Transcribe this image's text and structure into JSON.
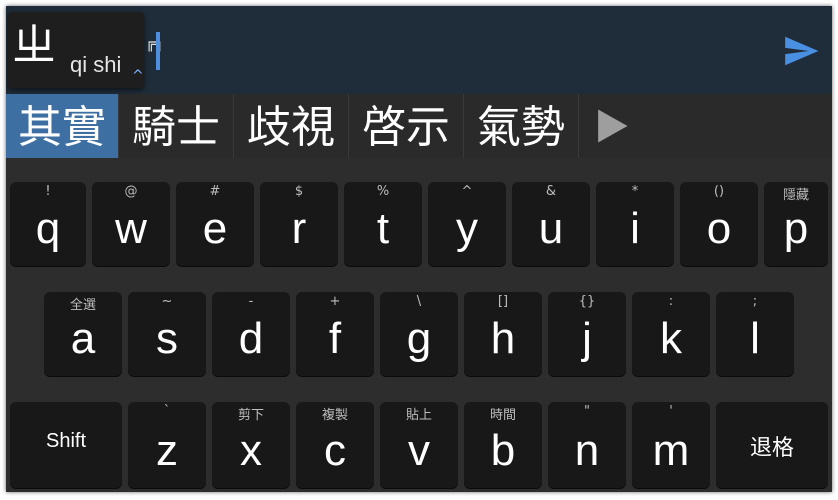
{
  "composer": {
    "zhuyin": "ㄓ",
    "pinyin": "qi shi",
    "caret": "^"
  },
  "typed_glyph": "╔╗",
  "send": {
    "icon": "send-icon",
    "color": "#4a90e2"
  },
  "candidates": [
    "其實",
    "騎士",
    "歧視",
    "啓示",
    "氣勢"
  ],
  "candidate_more_icon": "play-right-icon",
  "keyboard": {
    "row1": [
      {
        "main": "q",
        "hint": "!"
      },
      {
        "main": "w",
        "hint": "@"
      },
      {
        "main": "e",
        "hint": "#"
      },
      {
        "main": "r",
        "hint": "$"
      },
      {
        "main": "t",
        "hint": "%"
      },
      {
        "main": "y",
        "hint": "^"
      },
      {
        "main": "u",
        "hint": "&"
      },
      {
        "main": "i",
        "hint": "*"
      },
      {
        "main": "o",
        "hint": "()"
      },
      {
        "main": "p",
        "hint": "隱藏"
      }
    ],
    "row2": [
      {
        "main": "a",
        "hint": "全選"
      },
      {
        "main": "s",
        "hint": "~"
      },
      {
        "main": "d",
        "hint": "-"
      },
      {
        "main": "f",
        "hint": "+"
      },
      {
        "main": "g",
        "hint": "\\"
      },
      {
        "main": "h",
        "hint": "[]"
      },
      {
        "main": "j",
        "hint": "{}"
      },
      {
        "main": "k",
        "hint": ":"
      },
      {
        "main": "l",
        "hint": ";"
      }
    ],
    "row3": [
      {
        "main": "z",
        "hint": "`"
      },
      {
        "main": "x",
        "hint": "剪下"
      },
      {
        "main": "c",
        "hint": "複製"
      },
      {
        "main": "v",
        "hint": "貼上"
      },
      {
        "main": "b",
        "hint": "時間"
      },
      {
        "main": "n",
        "hint": "\""
      },
      {
        "main": "m",
        "hint": "'"
      }
    ],
    "shift_label": "Shift",
    "backspace_label": "退格"
  }
}
